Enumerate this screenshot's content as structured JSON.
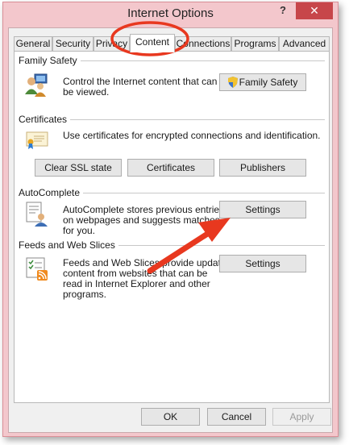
{
  "window": {
    "title": "Internet Options",
    "help": "?",
    "close": "✕"
  },
  "tabs": [
    {
      "label": "General"
    },
    {
      "label": "Security"
    },
    {
      "label": "Privacy"
    },
    {
      "label": "Content"
    },
    {
      "label": "Connections"
    },
    {
      "label": "Programs"
    },
    {
      "label": "Advanced"
    }
  ],
  "family_safety": {
    "heading": "Family Safety",
    "desc_line1": "Control the Internet content that can",
    "desc_line2": "be viewed.",
    "button": "Family Safety"
  },
  "certificates": {
    "heading": "Certificates",
    "desc": "Use certificates for encrypted connections and identification.",
    "clear_ssl": "Clear SSL state",
    "certificates": "Certificates",
    "publishers": "Publishers"
  },
  "autocomplete": {
    "heading": "AutoComplete",
    "desc_line1": "AutoComplete stores previous entries",
    "desc_line2": "on webpages and suggests matches",
    "desc_line3": "for you.",
    "button": "Settings"
  },
  "feeds": {
    "heading": "Feeds and Web Slices",
    "desc_line1": "Feeds and Web Slices provide updated",
    "desc_line2": "content from websites that can be",
    "desc_line3": "read in Internet Explorer and other",
    "desc_line4": "programs.",
    "button": "Settings"
  },
  "footer": {
    "ok": "OK",
    "cancel": "Cancel",
    "apply": "Apply"
  },
  "colors": {
    "annotation": "#e8381f",
    "frame": "#f3c7cc"
  }
}
